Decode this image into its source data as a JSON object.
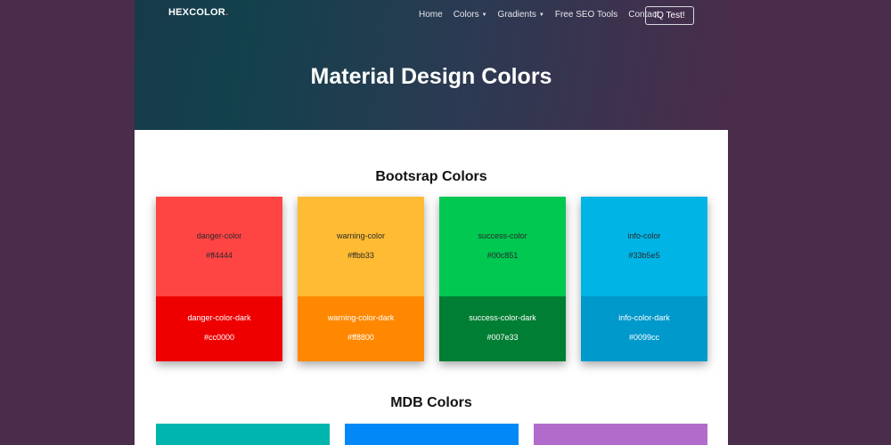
{
  "header": {
    "brand": "HEXCOLOR",
    "brand_dot": ".",
    "nav": [
      {
        "label": "Home",
        "dropdown": false
      },
      {
        "label": "Colors",
        "dropdown": true
      },
      {
        "label": "Gradients",
        "dropdown": true
      },
      {
        "label": "Free SEO Tools",
        "dropdown": false
      },
      {
        "label": "Contact",
        "dropdown": false
      }
    ],
    "cta_label": "IQ Test!",
    "title": "Material Design Colors"
  },
  "bootstrap": {
    "title": "Bootsrap Colors",
    "cards": [
      {
        "name": "danger-color",
        "hex": "#ff4444",
        "dark_name": "danger-color-dark",
        "dark_hex": "#cc0000",
        "color": "#ff4444",
        "dark_color": "#ee0000"
      },
      {
        "name": "warning-color",
        "hex": "#ffbb33",
        "dark_name": "warning-color-dark",
        "dark_hex": "#ff8800",
        "color": "#ffbb33",
        "dark_color": "#ff8800"
      },
      {
        "name": "success-color",
        "hex": "#00c851",
        "dark_name": "success-color-dark",
        "dark_hex": "#007e33",
        "color": "#00c851",
        "dark_color": "#007e33"
      },
      {
        "name": "info-color",
        "hex": "#33b5e5",
        "dark_name": "info-color-dark",
        "dark_hex": "#0099cc",
        "color": "#00b4e6",
        "dark_color": "#0099cc"
      }
    ]
  },
  "mdb": {
    "title": "MDB Colors",
    "colors": [
      "#00b5ad",
      "#0288f7",
      "#b16ccb"
    ]
  }
}
